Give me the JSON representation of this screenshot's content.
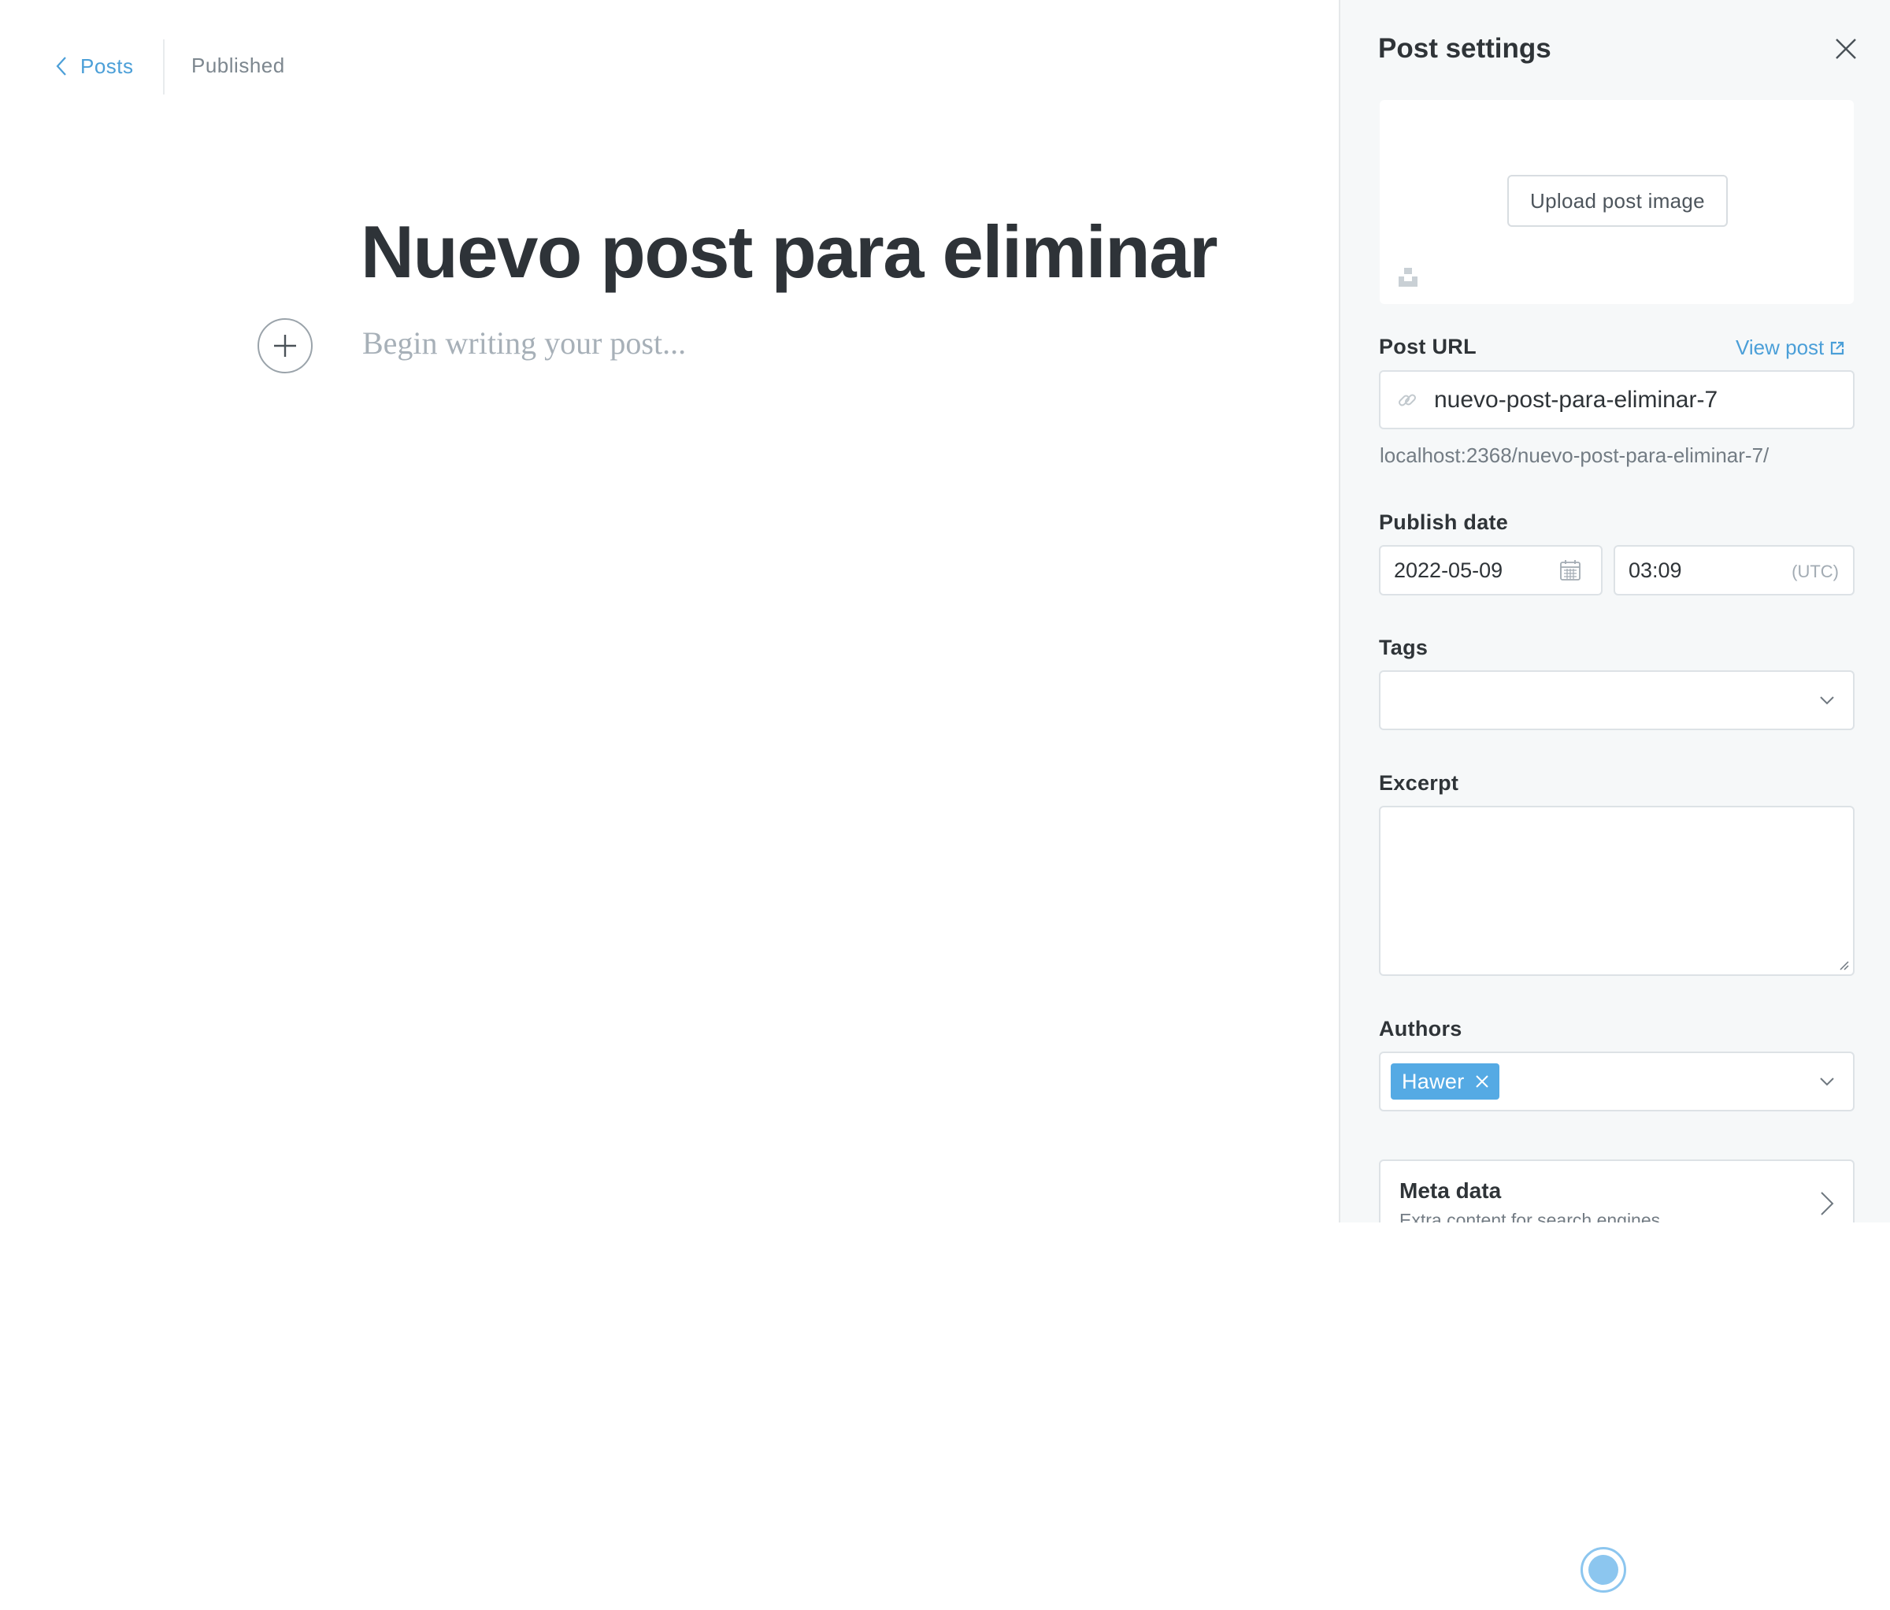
{
  "editor": {
    "back_link": "Posts",
    "status": "Published",
    "title": "Nuevo post para eliminar",
    "body_placeholder": "Begin writing your post..."
  },
  "settings": {
    "title": "Post settings",
    "upload_image_label": "Upload post image",
    "post_url_label": "Post URL",
    "view_post_label": "View post",
    "slug": "nuevo-post-para-eliminar-7",
    "url_preview": "localhost:2368/nuevo-post-para-eliminar-7/",
    "publish_date_label": "Publish date",
    "date": "2022-05-09",
    "time": "03:09",
    "timezone": "(UTC)",
    "tags_label": "Tags",
    "excerpt_label": "Excerpt",
    "excerpt": "",
    "authors_label": "Authors",
    "authors": [
      "Hawer"
    ],
    "meta_title": "Meta data",
    "meta_subtitle": "Extra content for search engines"
  },
  "colors": {
    "accent": "#4b9fd8",
    "author_chip": "#55aae4",
    "panel_bg": "#f6f8f9",
    "title_text": "#2e3338"
  },
  "icons": {
    "back": "chevron-left-icon",
    "add_card": "plus-icon",
    "close": "close-icon",
    "unsplash": "unsplash-icon",
    "external": "external-link-icon",
    "link": "link-icon",
    "calendar": "calendar-icon",
    "dropdown": "chevron-down-icon",
    "remove": "close-icon",
    "expand": "chevron-right-icon"
  }
}
